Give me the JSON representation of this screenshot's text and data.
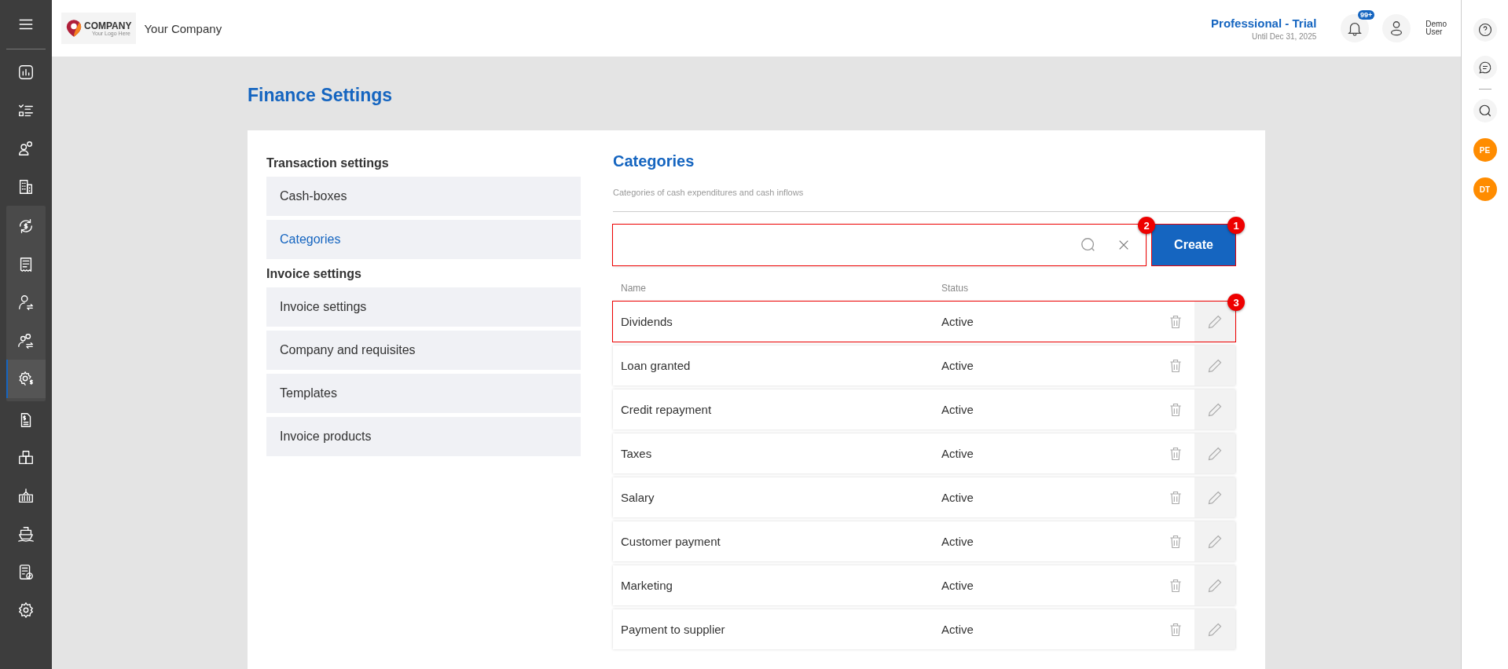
{
  "sidebar": {
    "items": [
      {
        "kind": "item",
        "selected": false
      },
      {
        "kind": "item",
        "selected": false
      },
      {
        "kind": "item",
        "selected": false
      },
      {
        "kind": "item",
        "selected": false
      },
      {
        "kind": "group",
        "expanded": true,
        "children": [
          {
            "selected": false
          },
          {
            "selected": false
          },
          {
            "selected": false
          },
          {
            "selected": false
          },
          {
            "selected": true
          }
        ]
      },
      {
        "kind": "item",
        "selected": false
      },
      {
        "kind": "item",
        "selected": false
      },
      {
        "kind": "item",
        "selected": false
      },
      {
        "kind": "item",
        "selected": false
      },
      {
        "kind": "item",
        "selected": false
      },
      {
        "kind": "item",
        "selected": false
      }
    ]
  },
  "header": {
    "logo": {
      "name": "COMPANY",
      "tagline": "Your Logo Here"
    },
    "company": "Your Company",
    "plan": "Professional - Trial",
    "plan_until": "Until Dec 31, 2025",
    "notifications_badge": "99+",
    "user": {
      "first": "Demo",
      "last": "User"
    }
  },
  "right_rail": {
    "avatars": [
      {
        "initials": "PE",
        "color": "#ff8c00"
      },
      {
        "initials": "DT",
        "color": "#ff8c00"
      }
    ]
  },
  "page": {
    "title": "Finance Settings"
  },
  "settings_menu": {
    "sections": [
      {
        "title": "Transaction settings",
        "items": [
          {
            "label": "Cash-boxes",
            "selected": false
          },
          {
            "label": "Categories",
            "selected": true
          }
        ]
      },
      {
        "title": "Invoice settings",
        "items": [
          {
            "label": "Invoice settings",
            "selected": false
          },
          {
            "label": "Company and requisites",
            "selected": false
          },
          {
            "label": "Templates",
            "selected": false
          },
          {
            "label": "Invoice products",
            "selected": false
          }
        ]
      }
    ]
  },
  "categories": {
    "title": "Categories",
    "subtitle": "Categories of cash expenditures and cash inflows",
    "search": {
      "annotation": "2"
    },
    "create_button": {
      "label": "Create",
      "annotation": "1"
    },
    "columns": [
      "Name",
      "Status"
    ],
    "rows": [
      {
        "name": "Dividends",
        "status": "Active",
        "annotation": "3"
      },
      {
        "name": "Loan granted",
        "status": "Active"
      },
      {
        "name": "Credit repayment",
        "status": "Active"
      },
      {
        "name": "Taxes",
        "status": "Active"
      },
      {
        "name": "Salary",
        "status": "Active"
      },
      {
        "name": "Customer payment",
        "status": "Active"
      },
      {
        "name": "Marketing",
        "status": "Active"
      },
      {
        "name": "Payment to supplier",
        "status": "Active"
      }
    ]
  }
}
